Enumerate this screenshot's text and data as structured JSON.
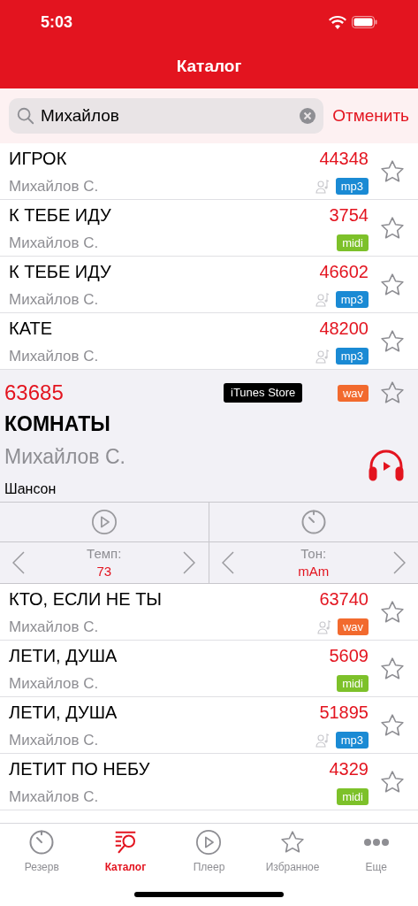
{
  "status_bar": {
    "time": "5:03"
  },
  "nav": {
    "title": "Каталог"
  },
  "search": {
    "value": "Михайлов",
    "cancel": "Отменить"
  },
  "songs_top": [
    {
      "kind": "row",
      "title": "ИГРОК",
      "number": "44348",
      "artist": "Михайлов С.",
      "vocal": true,
      "format": "mp3",
      "color": "#1a8ad4"
    },
    {
      "kind": "row",
      "title": "К ТЕБЕ ИДУ",
      "number": "3754",
      "artist": "Михайлов С.",
      "vocal": false,
      "format": "midi",
      "color": "#7dc12a"
    },
    {
      "kind": "row",
      "title": "К ТЕБЕ ИДУ",
      "number": "46602",
      "artist": "Михайлов С.",
      "vocal": true,
      "format": "mp3",
      "color": "#1a8ad4"
    },
    {
      "kind": "row",
      "title": "КАТЕ",
      "number": "48200",
      "artist": "Михайлов С.",
      "vocal": true,
      "format": "mp3",
      "color": "#1a8ad4"
    }
  ],
  "expanded": {
    "number": "63685",
    "store": "iTunes Store",
    "format": "wav",
    "color": "#f26a2e",
    "title": "КОМНАТЫ",
    "artist": "Михайлов С.",
    "genre": "Шансон",
    "tempo": {
      "label": "Темп:",
      "value": "73"
    },
    "key": {
      "label": "Тон:",
      "value": "mAm"
    }
  },
  "songs_bottom": [
    {
      "kind": "row",
      "title": "КТО, ЕСЛИ НЕ ТЫ",
      "number": "63740",
      "artist": "Михайлов С.",
      "vocal": true,
      "format": "wav",
      "color": "#f26a2e"
    },
    {
      "kind": "row",
      "title": "ЛЕТИ, ДУША",
      "number": "5609",
      "artist": "Михайлов С.",
      "vocal": false,
      "format": "midi",
      "color": "#7dc12a"
    },
    {
      "kind": "row",
      "title": "ЛЕТИ, ДУША",
      "number": "51895",
      "artist": "Михайлов С.",
      "vocal": true,
      "format": "mp3",
      "color": "#1a8ad4"
    },
    {
      "kind": "row",
      "title": "ЛЕТИТ ПО НЕБУ",
      "number": "4329",
      "artist": "Михайлов С.",
      "vocal": false,
      "format": "midi",
      "color": "#7dc12a"
    }
  ],
  "tab_bar": [
    {
      "kind": "timer",
      "label": "Резерв",
      "selected": false
    },
    {
      "kind": "catalog",
      "label": "Каталог",
      "selected": true
    },
    {
      "kind": "play",
      "label": "Плеер",
      "selected": false
    },
    {
      "kind": "star",
      "label": "Избранное",
      "selected": false
    },
    {
      "kind": "more",
      "label": "Еще",
      "selected": false
    }
  ]
}
